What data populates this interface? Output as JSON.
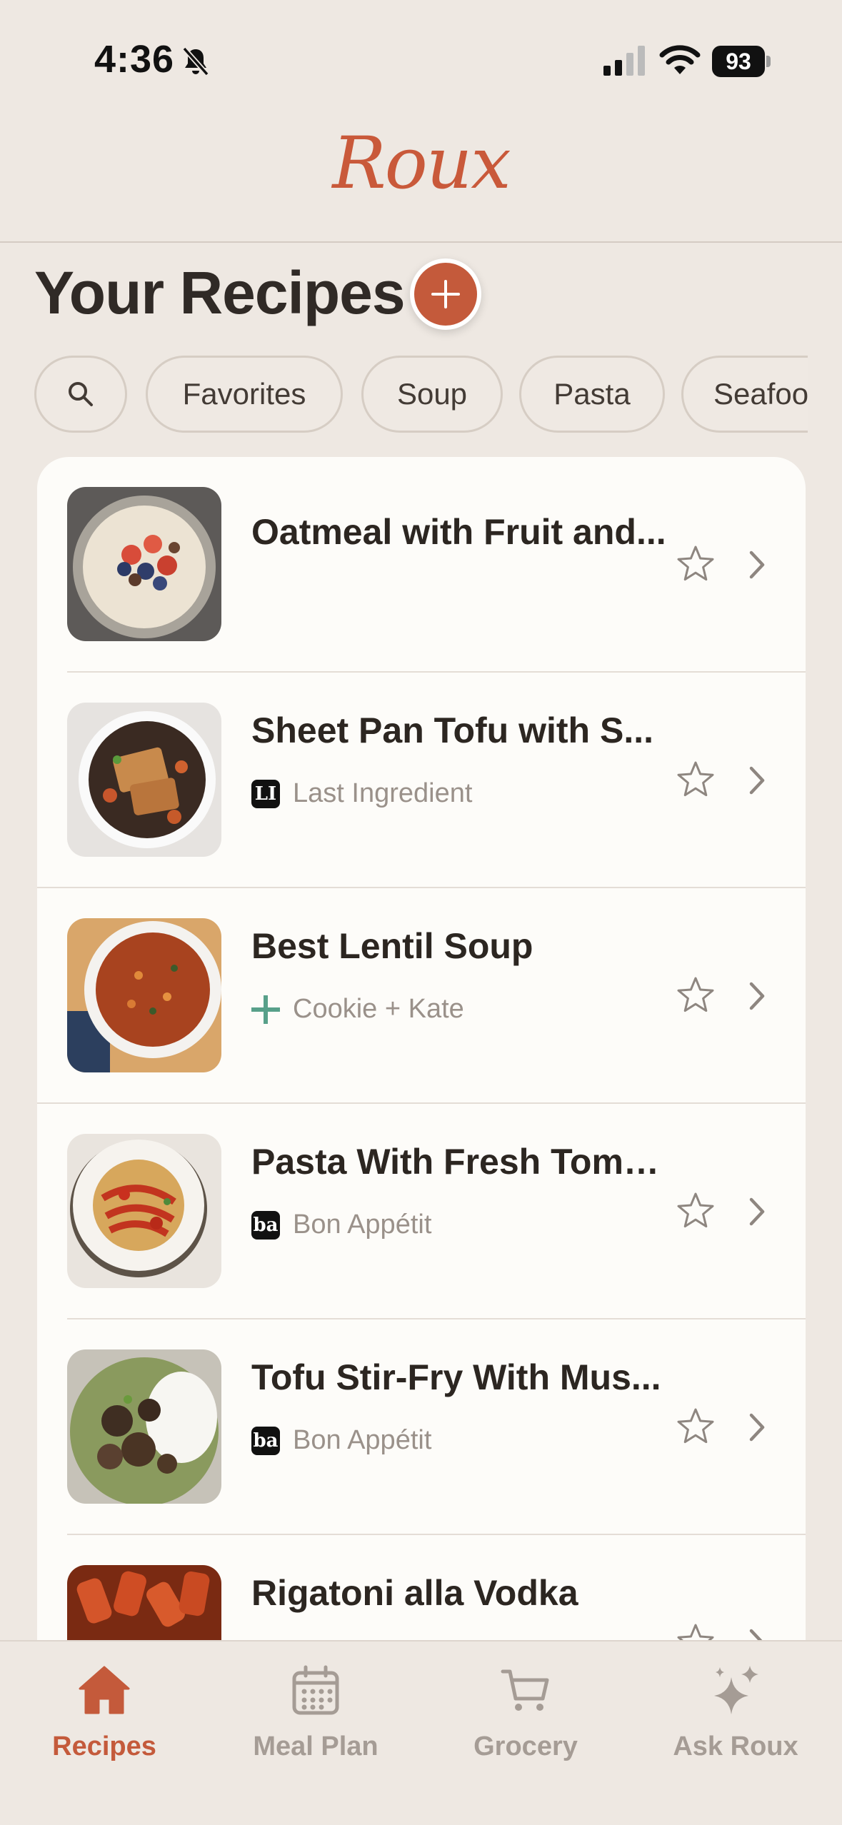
{
  "status_bar": {
    "time": "4:36",
    "battery": "93"
  },
  "app": {
    "logo": "Roux"
  },
  "page": {
    "title": "Your Recipes"
  },
  "filters": [
    "Favorites",
    "Soup",
    "Pasta",
    "Seafood"
  ],
  "recipes": [
    {
      "title": "Oatmeal with Fruit and Nuts",
      "title_display": "Oatmeal with Fruit and...",
      "source": "",
      "source_badge": ""
    },
    {
      "title": "Sheet Pan Tofu with S...",
      "title_display": "Sheet Pan Tofu with S...",
      "source": "Last Ingredient",
      "source_badge": "LI"
    },
    {
      "title": "Best Lentil Soup",
      "title_display": "Best Lentil Soup",
      "source": "Cookie + Kate",
      "source_badge": "+"
    },
    {
      "title": "Pasta With Fresh Toma...",
      "title_display": "Pasta With Fresh Toma...",
      "source": "Bon Appétit",
      "source_badge": "ba"
    },
    {
      "title": "Tofu Stir-Fry With Mus...",
      "title_display": "Tofu Stir-Fry With Mus...",
      "source": "Bon Appétit",
      "source_badge": "ba"
    },
    {
      "title": "Rigatoni alla Vodka",
      "title_display": "Rigatoni alla Vodka",
      "source": "",
      "source_badge": ""
    }
  ],
  "tabs": [
    {
      "label": "Recipes",
      "icon": "home-icon",
      "active": true
    },
    {
      "label": "Meal Plan",
      "icon": "calendar-icon",
      "active": false
    },
    {
      "label": "Grocery",
      "icon": "cart-icon",
      "active": false
    },
    {
      "label": "Ask Roux",
      "icon": "sparkles-icon",
      "active": false
    }
  ],
  "colors": {
    "accent": "#c45a3b",
    "background": "#eee8e2",
    "card": "#fdfcf9"
  }
}
